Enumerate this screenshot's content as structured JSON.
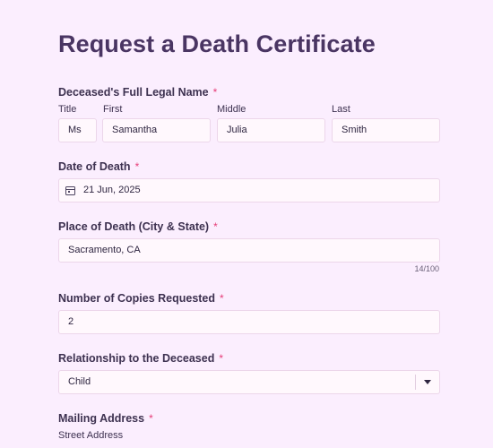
{
  "form": {
    "title": "Request a Death Certificate",
    "name_section": {
      "label": "Deceased's Full Legal Name",
      "required_mark": "*",
      "title_label": "Title",
      "title_value": "Ms",
      "first_label": "First",
      "first_value": "Samantha",
      "middle_label": "Middle",
      "middle_value": "Julia",
      "last_label": "Last",
      "last_value": "Smith"
    },
    "date_of_death": {
      "label": "Date of Death",
      "required_mark": "*",
      "value": "21 Jun, 2025",
      "icon": "calendar-icon"
    },
    "place_of_death": {
      "label": "Place of Death (City & State)",
      "required_mark": "*",
      "value": "Sacramento, CA",
      "char_count": "14/100"
    },
    "copies": {
      "label": "Number of Copies Requested",
      "required_mark": "*",
      "value": "2"
    },
    "relationship": {
      "label": "Relationship to the Deceased",
      "required_mark": "*",
      "value": "Child",
      "icon": "chevron-down-icon"
    },
    "mailing_address": {
      "label": "Mailing Address",
      "required_mark": "*",
      "street_label": "Street Address"
    }
  },
  "colors": {
    "background": "#fbeefe",
    "title": "#4a3563",
    "required": "#e63d78",
    "field_bg": "#fff8fd",
    "field_border": "#ecd6ea"
  }
}
